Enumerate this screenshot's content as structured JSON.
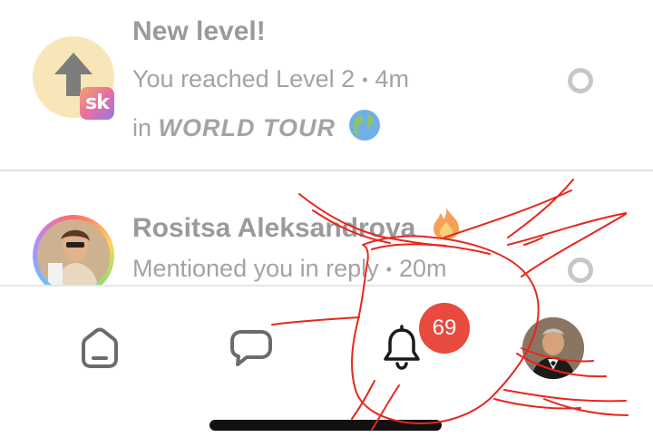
{
  "notifications": [
    {
      "title": "New level!",
      "message": "You reached Level 2",
      "separator": "•",
      "time": "4m",
      "context_prefix": "in",
      "group_name": "WORLD TOUR",
      "badge_text": "sk",
      "avatar_icon": "arrow-up-icon",
      "group_icon": "globe-americas-emoji",
      "read_indicator_icon": "unread-ring-icon"
    },
    {
      "title": "Rositsa Aleksandrova",
      "title_icon": "fire-emoji",
      "message": "Mentioned you in reply",
      "separator": "•",
      "time": "20m",
      "read_indicator_icon": "unread-ring-icon"
    }
  ],
  "tabbar": {
    "tabs": [
      {
        "name": "home",
        "icon": "home-icon"
      },
      {
        "name": "chats",
        "icon": "chat-bubble-icon"
      },
      {
        "name": "notifications",
        "icon": "bell-icon",
        "badge": "69",
        "active": true
      },
      {
        "name": "profile",
        "icon": "profile-avatar"
      }
    ]
  },
  "colors": {
    "badge": "#e84a3e",
    "scribble": "#e8261d",
    "muted_text": "#9a9a9a",
    "level_avatar_bg": "#f7e6b8"
  }
}
